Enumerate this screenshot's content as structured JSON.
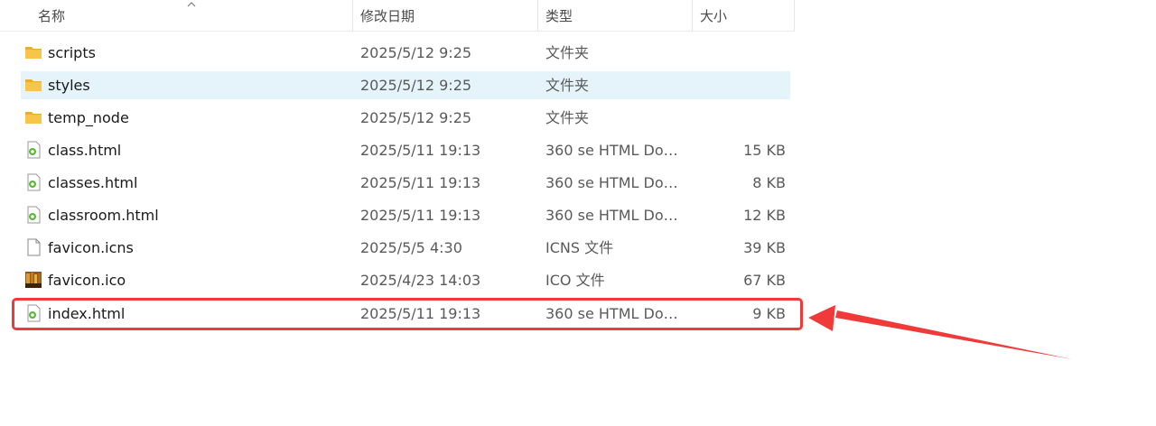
{
  "columns": {
    "name": "名称",
    "date": "修改日期",
    "type": "类型",
    "size": "大小"
  },
  "files": [
    {
      "name": "scripts",
      "date": "2025/5/12 9:25",
      "type": "文件夹",
      "size": "",
      "icon": "folder-icon"
    },
    {
      "name": "styles",
      "date": "2025/5/12 9:25",
      "type": "文件夹",
      "size": "",
      "icon": "folder-icon",
      "selected": true
    },
    {
      "name": "temp_node",
      "date": "2025/5/12 9:25",
      "type": "文件夹",
      "size": "",
      "icon": "folder-icon"
    },
    {
      "name": "class.html",
      "date": "2025/5/11 19:13",
      "type": "360 se HTML Docu...",
      "size": "15 KB",
      "icon": "html-file-icon"
    },
    {
      "name": "classes.html",
      "date": "2025/5/11 19:13",
      "type": "360 se HTML Docu...",
      "size": "8 KB",
      "icon": "html-file-icon"
    },
    {
      "name": "classroom.html",
      "date": "2025/5/11 19:13",
      "type": "360 se HTML Docu...",
      "size": "12 KB",
      "icon": "html-file-icon"
    },
    {
      "name": "favicon.icns",
      "date": "2025/5/5 4:30",
      "type": "ICNS 文件",
      "size": "39 KB",
      "icon": "blank-file-icon"
    },
    {
      "name": "favicon.ico",
      "date": "2025/4/23 14:03",
      "type": "ICO 文件",
      "size": "67 KB",
      "icon": "image-file-icon"
    },
    {
      "name": "index.html",
      "date": "2025/5/11 19:13",
      "type": "360 se HTML Docu...",
      "size": "9 KB",
      "icon": "html-file-icon",
      "highlighted": true
    }
  ],
  "colors": {
    "selected_row": "#e5f3fb",
    "annotation": "#f03a3a",
    "folder": "#f6c54a"
  }
}
